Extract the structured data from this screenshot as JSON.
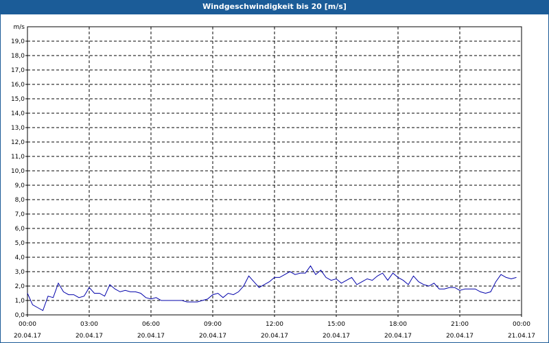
{
  "window": {
    "title": "Windgeschwindigkeit bis 20 [m/s]"
  },
  "chart_data": {
    "type": "line",
    "title": "Windgeschwindigkeit bis 20 [m/s]",
    "ylabel": "m/s",
    "xlabel": "",
    "ylim": [
      0,
      20
    ],
    "y_ticks": [
      "0,0",
      "1,0",
      "2,0",
      "3,0",
      "4,0",
      "5,0",
      "6,0",
      "7,0",
      "8,0",
      "9,0",
      "10,0",
      "11,0",
      "12,0",
      "13,0",
      "14,0",
      "15,0",
      "16,0",
      "17,0",
      "18,0",
      "19,0"
    ],
    "x_ticks": [
      {
        "time": "00:00",
        "date": "20.04.17"
      },
      {
        "time": "03:00",
        "date": "20.04.17"
      },
      {
        "time": "06:00",
        "date": "20.04.17"
      },
      {
        "time": "09:00",
        "date": "20.04.17"
      },
      {
        "time": "12:00",
        "date": "20.04.17"
      },
      {
        "time": "15:00",
        "date": "20.04.17"
      },
      {
        "time": "18:00",
        "date": "20.04.17"
      },
      {
        "time": "21:00",
        "date": "20.04.17"
      },
      {
        "time": "00:00",
        "date": "21.04.17"
      }
    ],
    "grid": true,
    "line_color": "#0000aa",
    "series": [
      {
        "x_hours": [
          0,
          0.25,
          0.5,
          0.75,
          1,
          1.25,
          1.5,
          1.75,
          2,
          2.25,
          2.5,
          2.75,
          3,
          3.25,
          3.5,
          3.75,
          4,
          4.25,
          4.5,
          4.75,
          5,
          5.25,
          5.5,
          5.75,
          6,
          6.25,
          6.5,
          6.75,
          7,
          7.25,
          7.5,
          7.75,
          8,
          8.25,
          8.5,
          8.75,
          9,
          9.25,
          9.5,
          9.75,
          10,
          10.25,
          10.5,
          10.75,
          11,
          11.25,
          11.5,
          11.75,
          12,
          12.25,
          12.5,
          12.75,
          13,
          13.25,
          13.5,
          13.75,
          14,
          14.25,
          14.5,
          14.75,
          15,
          15.25,
          15.5,
          15.75,
          16,
          16.25,
          16.5,
          16.75,
          17,
          17.25,
          17.5,
          17.75,
          18,
          18.25,
          18.5,
          18.75,
          19,
          19.25,
          19.5,
          19.75,
          20,
          20.25,
          20.5,
          20.75,
          21,
          21.25,
          21.5,
          21.75,
          22,
          22.25,
          22.5,
          22.75,
          23,
          23.25,
          23.5,
          23.75
        ],
        "values": [
          1.5,
          0.7,
          0.5,
          0.3,
          1.3,
          1.2,
          2.2,
          1.6,
          1.4,
          1.4,
          1.2,
          1.3,
          1.9,
          1.5,
          1.5,
          1.3,
          2.1,
          1.8,
          1.6,
          1.7,
          1.6,
          1.6,
          1.5,
          1.2,
          1.1,
          1.2,
          1.0,
          1.0,
          1.0,
          1.0,
          1.0,
          0.9,
          0.9,
          0.9,
          1.0,
          1.1,
          1.4,
          1.5,
          1.2,
          1.5,
          1.4,
          1.6,
          2.0,
          2.7,
          2.3,
          1.9,
          2.1,
          2.3,
          2.6,
          2.6,
          2.8,
          3.0,
          2.8,
          2.9,
          2.9,
          3.4,
          2.8,
          3.1,
          2.6,
          2.4,
          2.5,
          2.2,
          2.4,
          2.6,
          2.1,
          2.3,
          2.5,
          2.4,
          2.7,
          2.9,
          2.4,
          2.9,
          2.6,
          2.4,
          2.1,
          2.7,
          2.3,
          2.1,
          2.0,
          2.2,
          1.8,
          1.8,
          1.9,
          1.9,
          1.7,
          1.8,
          1.8,
          1.8,
          1.6,
          1.5,
          1.6,
          2.3,
          2.8,
          2.6,
          2.5,
          2.6
        ]
      }
    ]
  }
}
